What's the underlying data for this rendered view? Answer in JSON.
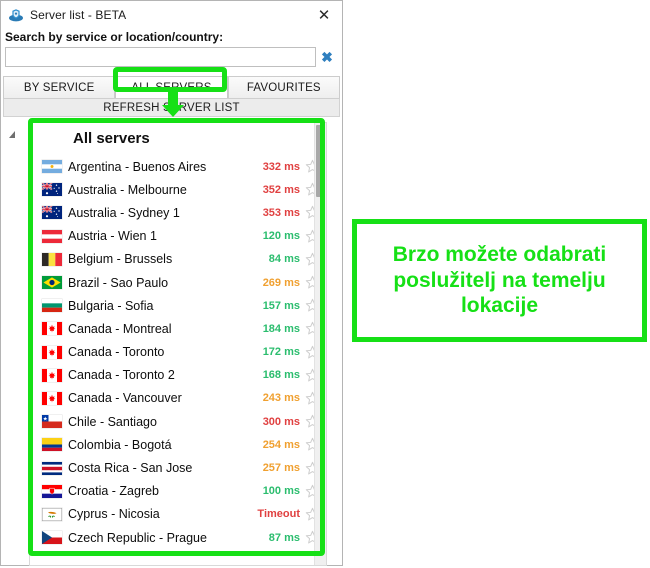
{
  "window": {
    "title": "Server list - BETA",
    "app_icon": "vpn-shield-icon",
    "close_label": "✕"
  },
  "search": {
    "label": "Search by service or location/country:",
    "value": "",
    "placeholder": "",
    "clear_label": "✖"
  },
  "tabs": [
    {
      "label": "BY SERVICE",
      "active": false
    },
    {
      "label": "ALL SERVERS",
      "active": true
    },
    {
      "label": "FAVOURITES",
      "active": false
    }
  ],
  "refresh": {
    "label": "REFRESH SERVER LIST"
  },
  "list": {
    "title": "All servers",
    "rows": [
      {
        "name": "Argentina - Buenos Aires",
        "ping": "332 ms",
        "ping_color": "#e04040",
        "flag": "argentina-flag"
      },
      {
        "name": "Australia - Melbourne",
        "ping": "352 ms",
        "ping_color": "#e04040",
        "flag": "australia-flag"
      },
      {
        "name": "Australia - Sydney 1",
        "ping": "353 ms",
        "ping_color": "#e04040",
        "flag": "australia-flag"
      },
      {
        "name": "Austria - Wien 1",
        "ping": "120 ms",
        "ping_color": "#2bbd6e",
        "flag": "austria-flag"
      },
      {
        "name": "Belgium - Brussels",
        "ping": "84 ms",
        "ping_color": "#2bbd6e",
        "flag": "belgium-flag"
      },
      {
        "name": "Brazil - Sao Paulo",
        "ping": "269 ms",
        "ping_color": "#f0a030",
        "flag": "brazil-flag"
      },
      {
        "name": "Bulgaria - Sofia",
        "ping": "157 ms",
        "ping_color": "#2bbd6e",
        "flag": "bulgaria-flag"
      },
      {
        "name": "Canada - Montreal",
        "ping": "184 ms",
        "ping_color": "#2bbd6e",
        "flag": "canada-flag"
      },
      {
        "name": "Canada - Toronto",
        "ping": "172 ms",
        "ping_color": "#2bbd6e",
        "flag": "canada-flag"
      },
      {
        "name": "Canada - Toronto 2",
        "ping": "168 ms",
        "ping_color": "#2bbd6e",
        "flag": "canada-flag"
      },
      {
        "name": "Canada - Vancouver",
        "ping": "243 ms",
        "ping_color": "#f0a030",
        "flag": "canada-flag"
      },
      {
        "name": "Chile - Santiago",
        "ping": "300 ms",
        "ping_color": "#e04040",
        "flag": "chile-flag"
      },
      {
        "name": "Colombia - Bogotá",
        "ping": "254 ms",
        "ping_color": "#f0a030",
        "flag": "colombia-flag"
      },
      {
        "name": "Costa Rica - San Jose",
        "ping": "257 ms",
        "ping_color": "#f0a030",
        "flag": "costarica-flag"
      },
      {
        "name": "Croatia - Zagreb",
        "ping": "100 ms",
        "ping_color": "#2bbd6e",
        "flag": "croatia-flag"
      },
      {
        "name": "Cyprus - Nicosia",
        "ping": "Timeout",
        "ping_color": "#e04040",
        "flag": "cyprus-flag"
      },
      {
        "name": "Czech Republic - Prague",
        "ping": "87 ms",
        "ping_color": "#2bbd6e",
        "flag": "czechia-flag"
      }
    ]
  },
  "annotation": {
    "text": "Brzo možete odabrati poslužitelj na temelju lokacije",
    "color": "#16e016"
  },
  "colors": {
    "highlight": "#16e016",
    "ping_good": "#2bbd6e",
    "ping_medium": "#f0a030",
    "ping_bad": "#e04040"
  }
}
